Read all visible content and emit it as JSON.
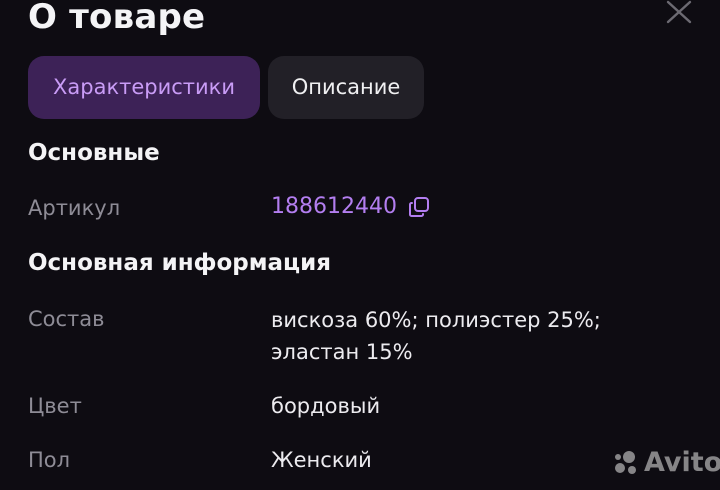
{
  "header": {
    "title": "О товаре",
    "close_icon": "close-icon"
  },
  "tabs": [
    {
      "label": "Характеристики",
      "active": true
    },
    {
      "label": "Описание",
      "active": false
    }
  ],
  "sections": {
    "basic": {
      "title": "Основные",
      "article_label": "Артикул",
      "article_value": "188612440",
      "copy_icon": "copy-icon"
    },
    "main_info": {
      "title": "Основная информация",
      "rows": [
        {
          "label": "Состав",
          "value": "вискоза 60%; полиэстер 25%; эластан 15%"
        },
        {
          "label": "Цвет",
          "value": "бордовый"
        },
        {
          "label": "Пол",
          "value": "Женский"
        }
      ]
    }
  },
  "watermark": {
    "text": "Avito"
  },
  "colors": {
    "background": "#0e0c12",
    "accent": "#b37ef0",
    "active_tab_bg": "#3d2257",
    "inactive_tab_bg": "#222027",
    "label": "#8e8c96"
  }
}
